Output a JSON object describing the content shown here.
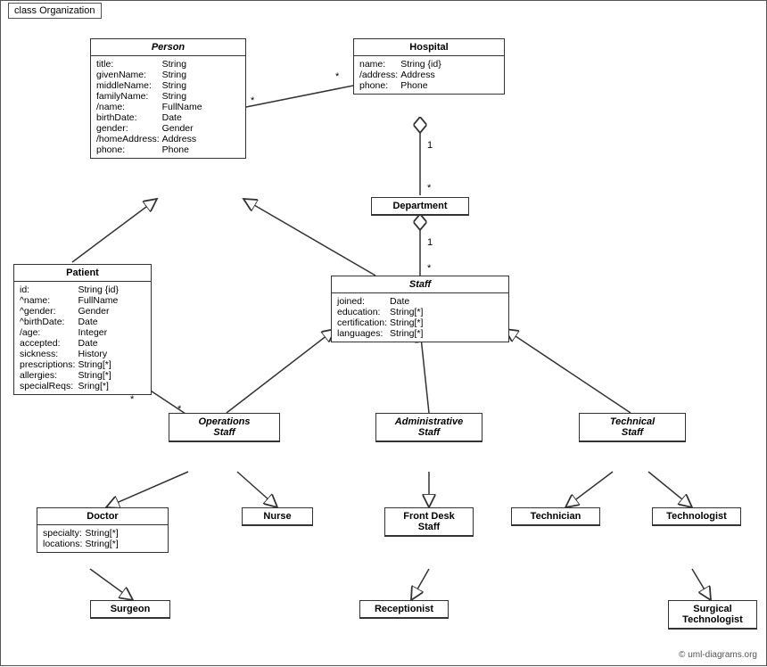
{
  "diagram": {
    "title": "class Organization",
    "copyright": "© uml-diagrams.org",
    "classes": {
      "person": {
        "name": "Person",
        "italic": true,
        "attrs": [
          [
            "title:",
            "String"
          ],
          [
            "givenName:",
            "String"
          ],
          [
            "middleName:",
            "String"
          ],
          [
            "familyName:",
            "String"
          ],
          [
            "/name:",
            "FullName"
          ],
          [
            "birthDate:",
            "Date"
          ],
          [
            "gender:",
            "Gender"
          ],
          [
            "/homeAddress:",
            "Address"
          ],
          [
            "phone:",
            "Phone"
          ]
        ]
      },
      "hospital": {
        "name": "Hospital",
        "italic": false,
        "attrs": [
          [
            "name:",
            "String {id}"
          ],
          [
            "/address:",
            "Address"
          ],
          [
            "phone:",
            "Phone"
          ]
        ]
      },
      "department": {
        "name": "Department",
        "italic": false,
        "attrs": []
      },
      "staff": {
        "name": "Staff",
        "italic": true,
        "attrs": [
          [
            "joined:",
            "Date"
          ],
          [
            "education:",
            "String[*]"
          ],
          [
            "certification:",
            "String[*]"
          ],
          [
            "languages:",
            "String[*]"
          ]
        ]
      },
      "patient": {
        "name": "Patient",
        "italic": false,
        "attrs": [
          [
            "id:",
            "String {id}"
          ],
          [
            "^name:",
            "FullName"
          ],
          [
            "^gender:",
            "Gender"
          ],
          [
            "^birthDate:",
            "Date"
          ],
          [
            "/age:",
            "Integer"
          ],
          [
            "accepted:",
            "Date"
          ],
          [
            "sickness:",
            "History"
          ],
          [
            "prescriptions:",
            "String[*]"
          ],
          [
            "allergies:",
            "String[*]"
          ],
          [
            "specialReqs:",
            "Sring[*]"
          ]
        ]
      },
      "operations_staff": {
        "name": "Operations Staff",
        "italic": true,
        "attrs": []
      },
      "administrative_staff": {
        "name": "Administrative Staff",
        "italic": true,
        "attrs": []
      },
      "technical_staff": {
        "name": "Technical Staff",
        "italic": true,
        "attrs": []
      },
      "doctor": {
        "name": "Doctor",
        "italic": false,
        "attrs": [
          [
            "specialty:",
            "String[*]"
          ],
          [
            "locations:",
            "String[*]"
          ]
        ]
      },
      "nurse": {
        "name": "Nurse",
        "italic": false,
        "attrs": []
      },
      "front_desk_staff": {
        "name": "Front Desk Staff",
        "italic": false,
        "attrs": []
      },
      "technician": {
        "name": "Technician",
        "italic": false,
        "attrs": []
      },
      "technologist": {
        "name": "Technologist",
        "italic": false,
        "attrs": []
      },
      "surgeon": {
        "name": "Surgeon",
        "italic": false,
        "attrs": []
      },
      "receptionist": {
        "name": "Receptionist",
        "italic": false,
        "attrs": []
      },
      "surgical_technologist": {
        "name": "Surgical Technologist",
        "italic": false,
        "attrs": []
      }
    }
  }
}
